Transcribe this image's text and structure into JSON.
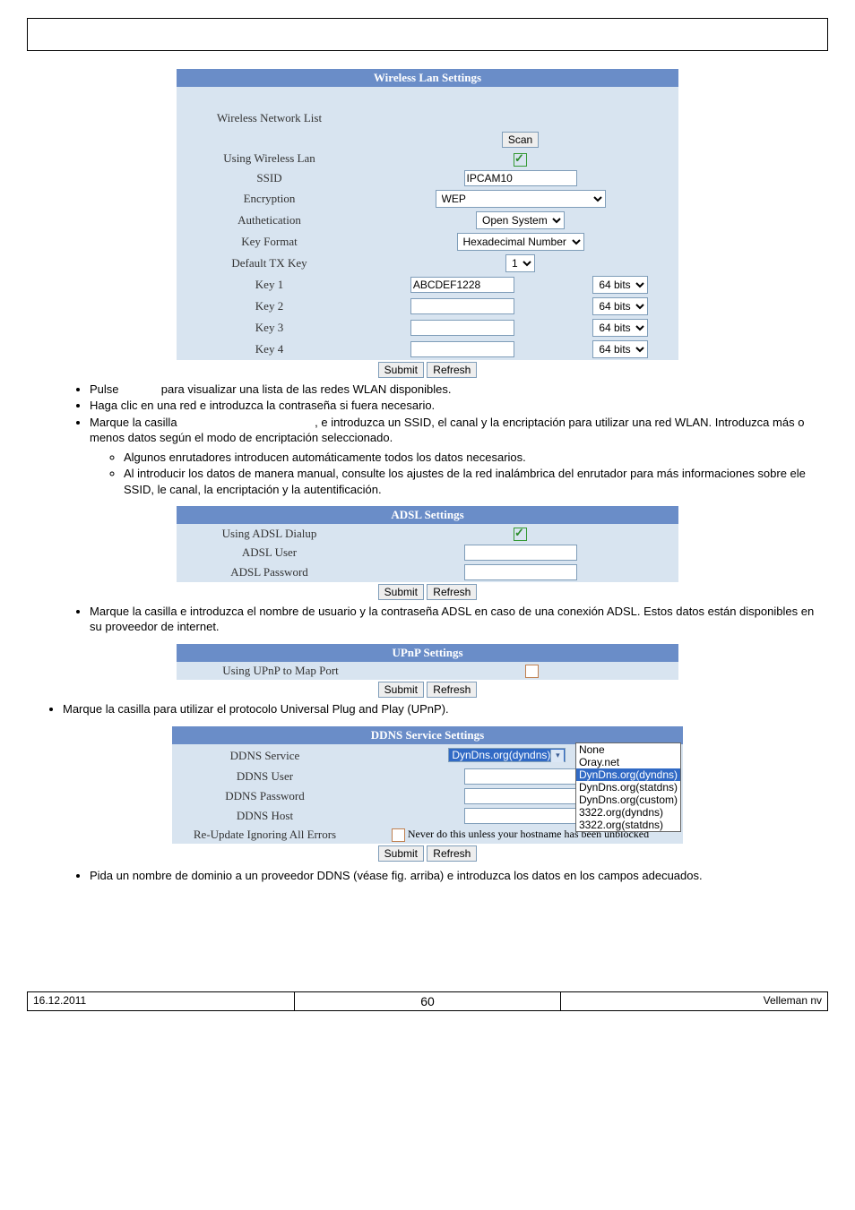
{
  "wlan": {
    "header": "Wireless Lan Settings",
    "wireless_network_list_label": "Wireless Network List",
    "scan": "Scan",
    "using_wireless_lan_label": "Using Wireless Lan",
    "ssid_label": "SSID",
    "ssid_value": "IPCAM10",
    "encryption_label": "Encryption",
    "encryption_value": "WEP",
    "authentication_label": "Authetication",
    "authentication_value": "Open System",
    "key_format_label": "Key Format",
    "key_format_value": "Hexadecimal Number",
    "default_tx_key_label": "Default TX Key",
    "default_tx_key_value": "1",
    "key1_label": "Key 1",
    "key1_value": "ABCDEF1228",
    "key1_bits": "64 bits",
    "key2_label": "Key 2",
    "key2_value": "",
    "key2_bits": "64 bits",
    "key3_label": "Key 3",
    "key3_value": "",
    "key3_bits": "64 bits",
    "key4_label": "Key 4",
    "key4_value": "",
    "key4_bits": "64 bits",
    "submit": "Submit",
    "refresh": "Refresh"
  },
  "text": {
    "li1a": "Pulse ",
    "li1b": " para visualizar una lista de las redes WLAN disponibles.",
    "li2": "Haga clic en una red e introduzca la contraseña si fuera necesario.",
    "li3a": "Marque la casilla ",
    "li3b": ", e introduzca un SSID, el canal y la encriptación para utilizar una red WLAN. Introduzca más o menos datos según el modo de encriptación seleccionado.",
    "sub1": "Algunos enrutadores introducen automáticamente todos los datos necesarios.",
    "sub2": "Al introducir los datos de manera manual, consulte los ajustes de la red inalámbrica del enrutador para más informaciones sobre ele SSID, le canal, la encriptación y la autentificación.",
    "adsl_li": "Marque la casilla e introduzca el nombre de usuario y la contraseña ADSL en caso de una conexión ADSL. Estos datos están disponibles en su proveedor de internet.",
    "upnp_li": "Marque la casilla para utilizar el protocolo Universal Plug and Play (UPnP).",
    "ddns_li": "Pida un nombre de dominio a un proveedor DDNS (véase fig. arriba) e introduzca los datos en los campos adecuados."
  },
  "adsl": {
    "header": "ADSL Settings",
    "using_label": "Using ADSL Dialup",
    "user_label": "ADSL User",
    "password_label": "ADSL Password",
    "submit": "Submit",
    "refresh": "Refresh"
  },
  "upnp": {
    "header": "UPnP Settings",
    "using_label": "Using UPnP to Map Port",
    "submit": "Submit",
    "refresh": "Refresh"
  },
  "ddns": {
    "header": "DDNS Service Settings",
    "service_label": "DDNS Service",
    "service_value": "DynDns.org(dyndns)",
    "user_label": "DDNS User",
    "password_label": "DDNS Password",
    "host_label": "DDNS Host",
    "reupdate_label": "Re-Update Ignoring All Errors",
    "reupdate_note": "Never do this unless your hostname has been unblocked",
    "submit": "Submit",
    "refresh": "Refresh",
    "options": [
      "None",
      "Oray.net",
      "DynDns.org(dyndns)",
      "DynDns.org(statdns)",
      "DynDns.org(custom)",
      "3322.org(dyndns)",
      "3322.org(statdns)"
    ]
  },
  "footer": {
    "date": "16.12.2011",
    "page": "60",
    "company": "Velleman nv"
  }
}
